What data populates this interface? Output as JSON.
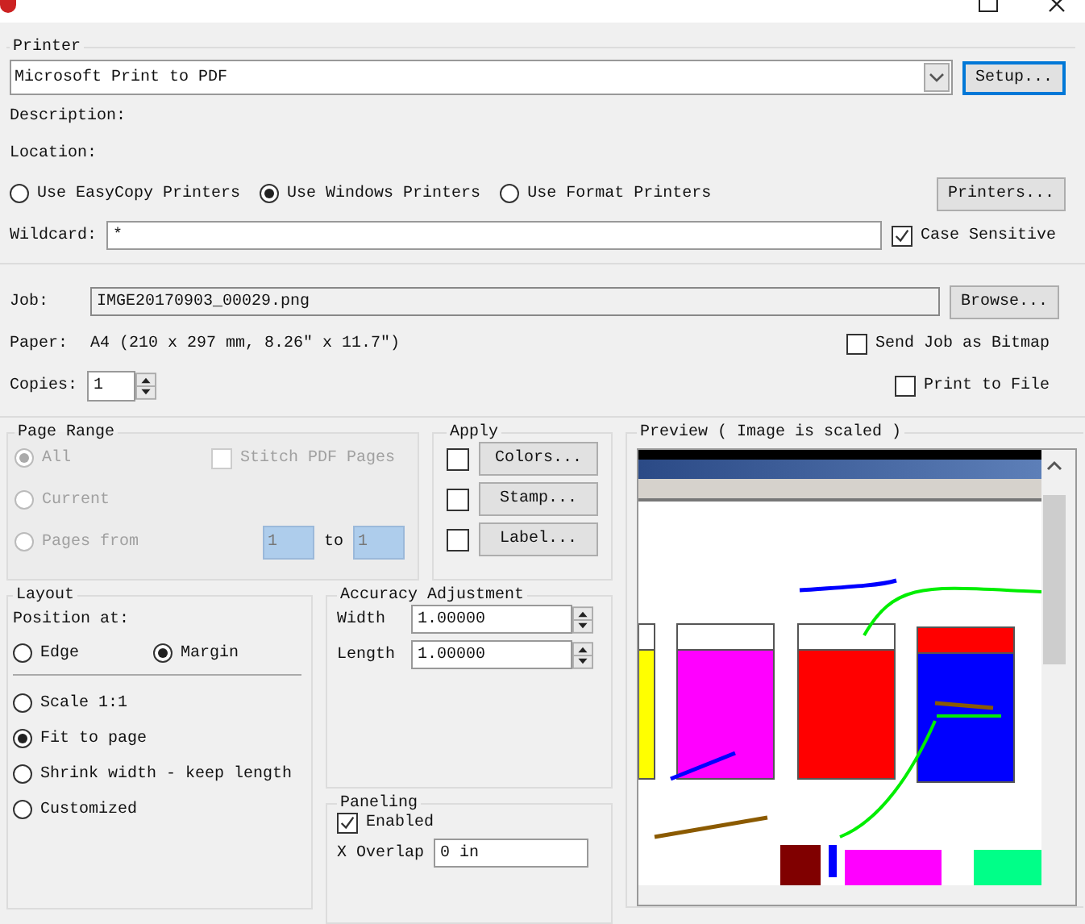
{
  "printer": {
    "title": "Printer",
    "selected_printer": "Microsoft Print to PDF",
    "setup_button": "Setup...",
    "description_label": "Description:",
    "location_label": "Location:",
    "sources": [
      {
        "label": "Use EasyCopy Printers",
        "selected": false
      },
      {
        "label": "Use Windows Printers",
        "selected": true
      },
      {
        "label": "Use Format Printers",
        "selected": false
      }
    ],
    "printers_button": "Printers...",
    "wildcard_label": "Wildcard:",
    "wildcard_value": "*",
    "case_sensitive": {
      "label": "Case Sensitive",
      "checked": true
    }
  },
  "job": {
    "label": "Job:",
    "value": "IMGE20170903_00029.png",
    "browse_button": "Browse...",
    "paper_label": "Paper:",
    "paper_value": "A4 (210 x 297 mm, 8.26\" x 11.7\")",
    "send_as_bitmap": {
      "label": "Send Job as Bitmap",
      "checked": false
    },
    "copies_label": "Copies:",
    "copies_value": "1",
    "print_to_file": {
      "label": "Print to File",
      "checked": false
    }
  },
  "page_range": {
    "title": "Page Range",
    "disabled": true,
    "options": [
      {
        "label": "All",
        "selected": true
      },
      {
        "label": "Current",
        "selected": false
      },
      {
        "label": "Pages from",
        "selected": false
      }
    ],
    "stitch": {
      "label": "Stitch PDF Pages",
      "checked": false
    },
    "from_value": "1",
    "to_label": "to",
    "to_value": "1"
  },
  "apply": {
    "title": "Apply",
    "items": [
      {
        "label": "Colors...",
        "checked": false
      },
      {
        "label": "Stamp...",
        "checked": false
      },
      {
        "label": "Label...",
        "checked": false
      }
    ]
  },
  "preview": {
    "title": "Preview ( Image is scaled )"
  },
  "layout": {
    "title": "Layout",
    "position_label": "Position at:",
    "position_options": [
      {
        "label": "Edge",
        "selected": false
      },
      {
        "label": "Margin",
        "selected": true
      }
    ],
    "scale_options": [
      {
        "label": "Scale 1:1",
        "selected": false
      },
      {
        "label": "Fit to page",
        "selected": true
      },
      {
        "label": "Shrink width - keep length",
        "selected": false
      },
      {
        "label": "Customized",
        "selected": false
      }
    ]
  },
  "accuracy": {
    "title": "Accuracy Adjustment",
    "fields": [
      {
        "label": "Width",
        "value": "1.00000"
      },
      {
        "label": "Length",
        "value": "1.00000"
      }
    ]
  },
  "paneling": {
    "title": "Paneling",
    "enabled": {
      "label": "Enabled",
      "checked": true
    },
    "x_overlap_label": "X Overlap",
    "x_overlap_value": "0 in"
  }
}
